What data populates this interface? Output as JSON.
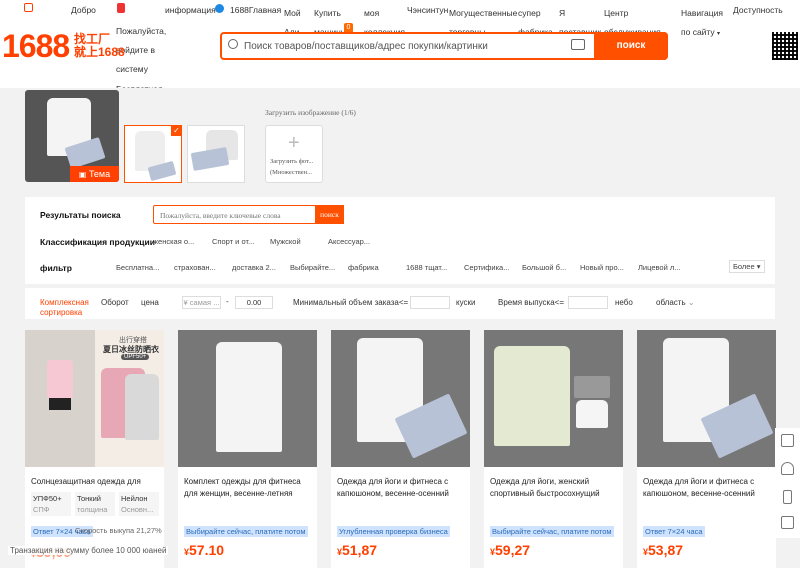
{
  "topnav": {
    "dobro": "Добро",
    "info": "информация",
    "main": "1688Главная",
    "my": "Мой",
    "ali": "Али",
    "buy_l1": "Купить",
    "buy_l2": "машину",
    "coll_l1": "моя",
    "coll_l2": "коллекция",
    "cart_count": "0",
    "yansintun": "Чэнсинтун",
    "powerful_l1": "Могущественные",
    "powerful_l2": "торговцы",
    "super_l1": "супер",
    "super_l2": "фабрика",
    "ya_l1": "Я",
    "ya_l2": "поставщик",
    "center_l1": "Центр",
    "center_l2": "обслуживания",
    "nav_l1": "Навигация",
    "nav_l2": "по сайту",
    "dostup": "Доступность",
    "welcome_l1": "Пожалуйста,",
    "welcome_l2": "войдите в",
    "welcome_l3": "систему",
    "free_l1": "Бесплатная",
    "free_l2": "регистрация"
  },
  "logo": {
    "number": "1688",
    "sub1": "找工厂",
    "sub2": "就上1688"
  },
  "search": {
    "placeholder": "Поиск товаров/поставщиков/адрес покупки/картинки",
    "button": "поиск"
  },
  "image_strip": {
    "tema": "Тема",
    "upload_title": "Загрузить изображение (1/6)",
    "upload_label_1": "Загрузить фот...",
    "upload_label_2": "(Множествен..."
  },
  "filters": {
    "results_label": "Результаты поиска",
    "search_placeholder": "Пожалуйста, введите ключевые слова",
    "search_button": "поиск",
    "classification_label": "Классификация продукции",
    "categories": [
      "женская о...",
      "Спорт и от...",
      "Мужской",
      "Аксессуар..."
    ],
    "filter_label": "фильтр",
    "filter_items": [
      "Бесплатна...",
      "страхован...",
      "доставка 2...",
      "Выбирайте...",
      "фабрика",
      "1688 тщат...",
      "Сертифика...",
      "Большой б...",
      "Новый про...",
      "Лицевой л..."
    ],
    "more": "Более"
  },
  "sort": {
    "complex_l1": "Комплексная",
    "complex_l2": "сортировка",
    "turnover": "Оборот",
    "price": "цена",
    "price_min": "¥ самая ...",
    "price_dash": "-",
    "price_max": "0.00",
    "moq_label": "Минимальный объем заказа<=",
    "moq_unit": "куски",
    "release_label": "Время выпуска<=",
    "release_unit": "небо",
    "region": "область"
  },
  "cards": [
    {
      "title": "Солнцезащитная одежда для",
      "attrs": [
        "УПФ50+",
        "Тонкий",
        "Нейлон"
      ],
      "attrs2": [
        "СПФ",
        "толщина",
        "Основн..."
      ],
      "tag": "Ответ 7×24 часа",
      "extra": "Скорость выкупа 21,27%",
      "price": "39,00",
      "promo_top": "出行穿搭",
      "promo_main": "夏日冰丝防晒衣",
      "promo_badge": "UPF50+"
    },
    {
      "title": "Комплект одежды для фитнеса для женщин, весенне-летняя",
      "tag": "Выбирайте сейчас, платите потом",
      "price": "57.10"
    },
    {
      "title": "Одежда для йоги и фитнеса с капюшоном, весенне-осенний",
      "tag": "Углубленная проверка бизнеса",
      "price": "51,87"
    },
    {
      "title": "Одежда для йоги, женский спортивный быстросохнущий",
      "tag": "Выбирайте сейчас, платите потом",
      "price": "59,27"
    },
    {
      "title": "Одежда для йоги и фитнеса с капюшоном, весенне-осенний",
      "tag": "Ответ 7×24 часа",
      "price": "53,87"
    }
  ],
  "currency": "¥",
  "footer_note": "Транзакция на сумму более 10 000 юаней",
  "colors": {
    "brand": "#ff5000",
    "price": "#ff4000",
    "tag_bg": "#cfe3ff"
  }
}
